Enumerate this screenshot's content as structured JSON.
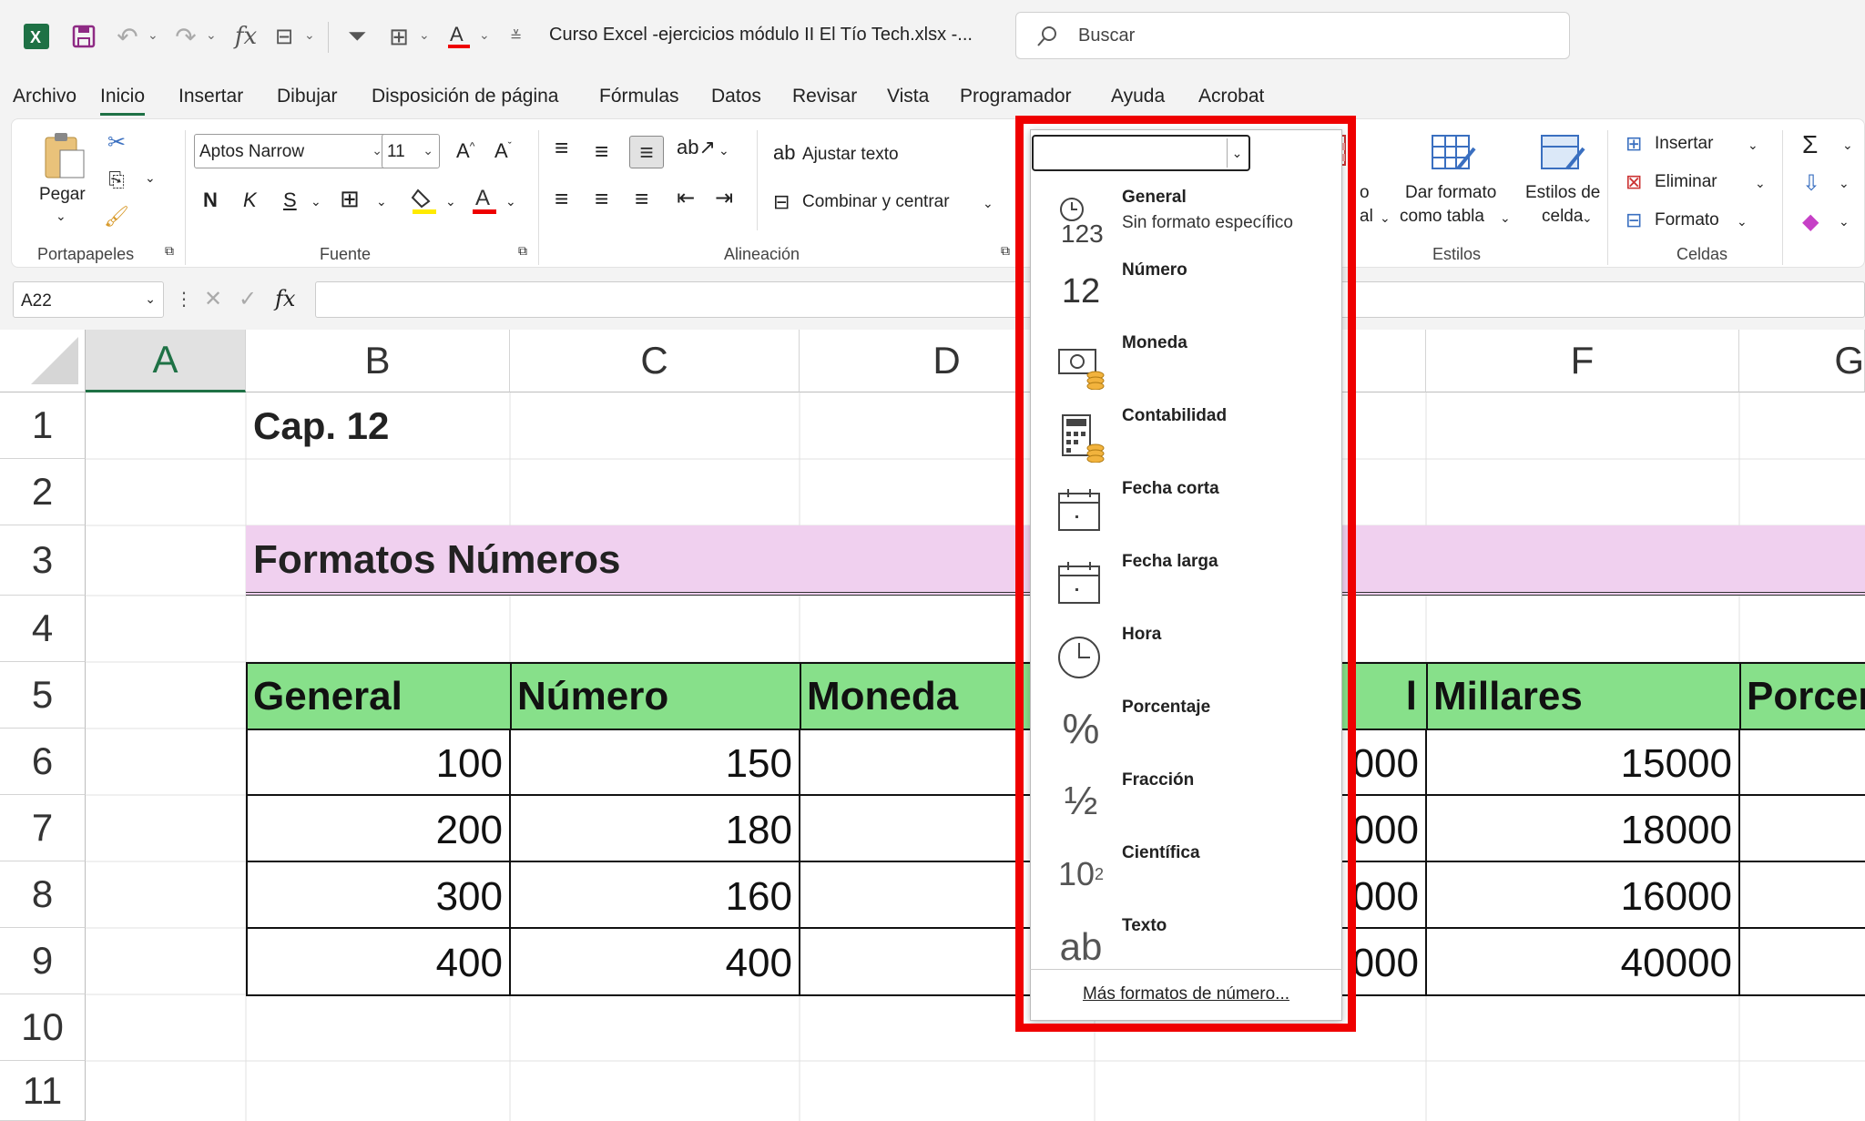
{
  "titlebar": {
    "filename": "Curso Excel -ejercicios módulo II El Tío Tech.xlsx  -...",
    "search_placeholder": "Buscar"
  },
  "menu": [
    "Archivo",
    "Inicio",
    "Insertar",
    "Dibujar",
    "Disposición de página",
    "Fórmulas",
    "Datos",
    "Revisar",
    "Vista",
    "Programador",
    "Ayuda",
    "Acrobat"
  ],
  "ribbon": {
    "clipboard": {
      "paste_label": "Pegar",
      "group": "Portapapeles"
    },
    "font": {
      "family": "Aptos Narrow",
      "size": "11",
      "bold": "N",
      "italic": "K",
      "underline": "S",
      "grow": "A^",
      "shrink": "Aˇ",
      "group": "Fuente"
    },
    "alignment": {
      "wrap": "Ajustar texto",
      "merge": "Combinar y centrar",
      "group": "Alineación"
    },
    "styles": {
      "cond_partial": "o",
      "cond_partial2": "al",
      "format_table": [
        "Dar formato",
        "como tabla"
      ],
      "cell_styles": [
        "Estilos de",
        "celda"
      ],
      "group": "Estilos"
    },
    "cells": {
      "insert": "Insertar",
      "delete": "Eliminar",
      "format": "Formato",
      "group": "Celdas"
    }
  },
  "formula_bar": {
    "namebox": "A22",
    "fx": "fx"
  },
  "sheet": {
    "columns": [
      "A",
      "B",
      "C",
      "D",
      "F",
      "G"
    ],
    "rows": [
      "1",
      "2",
      "3",
      "4",
      "5",
      "6",
      "7",
      "8",
      "9",
      "10",
      "11"
    ],
    "b1": "Cap. 12",
    "b3": "Formatos Números",
    "headers": [
      "General",
      "Número",
      "Moneda",
      "l",
      "Millares",
      "Porcer"
    ],
    "general": [
      "100",
      "200",
      "300",
      "400"
    ],
    "numero": [
      "150",
      "180",
      "160",
      "400"
    ],
    "e_partial": [
      "000",
      "000",
      "000",
      "000"
    ],
    "millares": [
      "15000",
      "18000",
      "16000",
      "40000"
    ]
  },
  "number_format_dropdown": {
    "items": [
      {
        "label": "General",
        "sub": "Sin formato específico",
        "icon": "clock-123-icon"
      },
      {
        "label": "Número",
        "icon": "number-12-icon"
      },
      {
        "label": "Moneda",
        "icon": "currency-icon"
      },
      {
        "label": "Contabilidad",
        "icon": "calculator-icon"
      },
      {
        "label": "Fecha corta",
        "icon": "calendar-icon"
      },
      {
        "label": "Fecha larga",
        "icon": "calendar-icon"
      },
      {
        "label": "Hora",
        "icon": "clock-icon"
      },
      {
        "label": "Porcentaje",
        "icon": "percent-icon"
      },
      {
        "label": "Fracción",
        "icon": "fraction-icon"
      },
      {
        "label": "Científica",
        "icon": "scientific-icon"
      },
      {
        "label": "Texto",
        "icon": "text-ab-icon"
      }
    ],
    "more": "Más formatos de número..."
  },
  "colors": {
    "accent_green": "#1e7145",
    "header_green": "#87e08a",
    "title_pink": "#f0d0ef",
    "highlight_red": "#ef0000"
  }
}
